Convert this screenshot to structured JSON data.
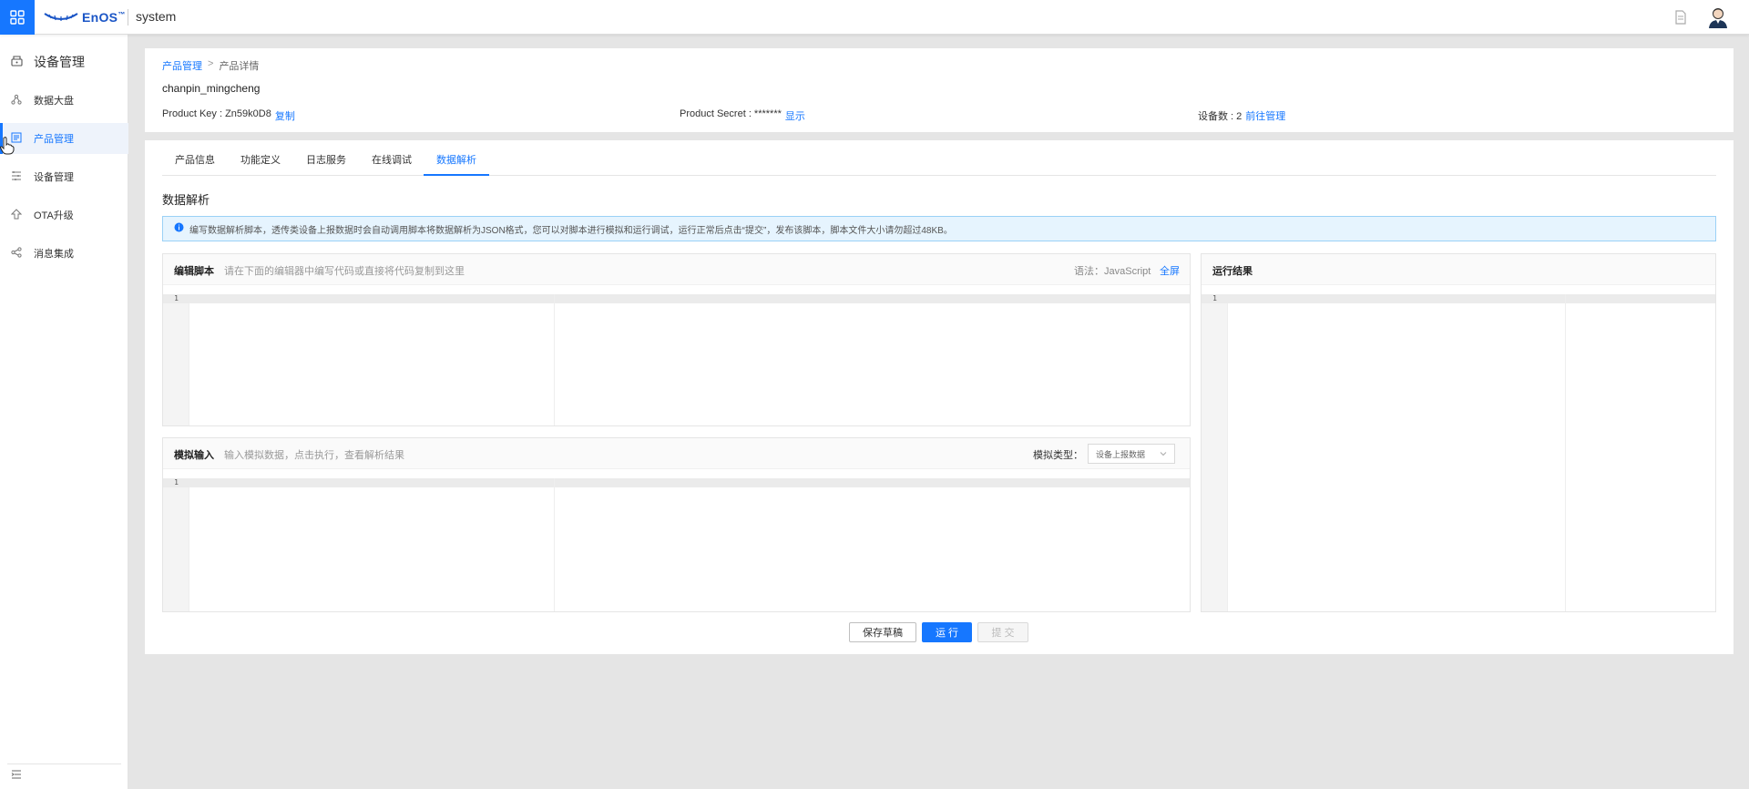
{
  "colors": {
    "accent": "#1677ff",
    "info_bg": "#e6f4fe"
  },
  "topbar": {
    "logo_text": "EnOS",
    "logo_mark": "™",
    "title": "system",
    "icons": [
      "app-grid-icon",
      "document-icon",
      "user-avatar-icon"
    ]
  },
  "sidebar": {
    "header": "设备管理",
    "items": [
      {
        "label": "数据大盘",
        "icon": "dashboard-icon",
        "active": false
      },
      {
        "label": "产品管理",
        "icon": "product-icon",
        "active": true
      },
      {
        "label": "设备管理",
        "icon": "device-list-icon",
        "active": false
      },
      {
        "label": "OTA升级",
        "icon": "upgrade-icon",
        "active": false
      },
      {
        "label": "消息集成",
        "icon": "share-icon",
        "active": false
      }
    ]
  },
  "breadcrumb": {
    "parent": "产品管理",
    "sep": ">",
    "current": "产品详情"
  },
  "product": {
    "name": "chanpin_mingcheng",
    "key_label": "Product Key : Zn59k0D8",
    "key_action": "复制",
    "secret_label": "Product Secret : *******",
    "secret_action": "显示",
    "devices_label": "设备数 : 2",
    "devices_action": "前往管理"
  },
  "tabs": [
    "产品信息",
    "功能定义",
    "日志服务",
    "在线调试",
    "数据解析"
  ],
  "active_tab": "数据解析",
  "section_title": "数据解析",
  "notice": "编写数据解析脚本，透传类设备上报数据时会自动调用脚本将数据解析为JSON格式，您可以对脚本进行模拟和运行调试，运行正常后点击“提交”，发布该脚本，脚本文件大小请勿超过48KB。",
  "editor": {
    "title": "编辑脚本",
    "hint": "请在下面的编辑器中编写代码或直接将代码复制到这里",
    "lang": "语法：JavaScript",
    "fullscreen": "全屏",
    "line": "1"
  },
  "sim": {
    "title": "模拟输入",
    "hint": "输入模拟数据，点击执行，查看解析结果",
    "type_label": "模拟类型：",
    "type_value": "设备上报数据",
    "line": "1"
  },
  "result": {
    "title": "运行结果",
    "line": "1"
  },
  "buttons": {
    "save": "保存草稿",
    "run": "运 行",
    "submit": "提 交"
  }
}
